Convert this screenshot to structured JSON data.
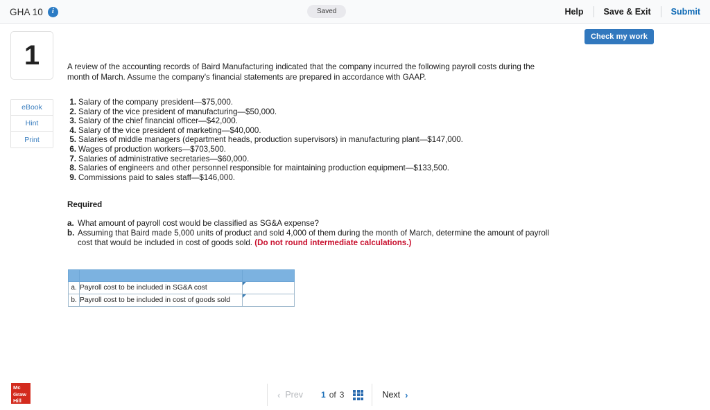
{
  "header": {
    "assignment_title": "GHA 10",
    "info_icon": "info-icon",
    "saved_label": "Saved",
    "help_label": "Help",
    "save_exit_label": "Save & Exit",
    "submit_label": "Submit"
  },
  "toolbar": {
    "check_my_work_label": "Check my work"
  },
  "left_rail": {
    "question_number": "1",
    "tools": [
      {
        "label": "eBook",
        "name": "ebook-button"
      },
      {
        "label": "Hint",
        "name": "hint-button"
      },
      {
        "label": "Print",
        "name": "print-button"
      }
    ]
  },
  "question": {
    "intro": "A review of the accounting records of Baird Manufacturing indicated that the company incurred the following payroll costs during the month of March. Assume the company's financial statements are prepared in accordance with GAAP.",
    "items": [
      {
        "num": "1.",
        "text": "Salary of the company president—$75,000."
      },
      {
        "num": "2.",
        "text": "Salary of the vice president of manufacturing—$50,000."
      },
      {
        "num": "3.",
        "text": "Salary of the chief financial officer—$42,000."
      },
      {
        "num": "4.",
        "text": "Salary of the vice president of marketing—$40,000."
      },
      {
        "num": "5.",
        "text": "Salaries of middle managers (department heads, production supervisors) in manufacturing plant—$147,000."
      },
      {
        "num": "6.",
        "text": "Wages of production workers—$703,500."
      },
      {
        "num": "7.",
        "text": "Salaries of administrative secretaries—$60,000."
      },
      {
        "num": "8.",
        "text": "Salaries of engineers and other personnel responsible for maintaining production equipment—$133,500."
      },
      {
        "num": "9.",
        "text": "Commissions paid to sales staff—$146,000."
      }
    ],
    "required_heading": "Required",
    "requirements": [
      {
        "letter": "a.",
        "text": "What amount of payroll cost would be classified as SG&A expense?",
        "emphasis": ""
      },
      {
        "letter": "b.",
        "text": "Assuming that Baird made 5,000 units of product and sold 4,000 of them during the month of March, determine the amount of payroll cost that would be included in cost of goods sold. ",
        "emphasis": "(Do not round intermediate calculations.)"
      }
    ]
  },
  "answer_table": {
    "header_cells": [
      "",
      "",
      ""
    ],
    "rows": [
      {
        "letter": "a.",
        "label": "Payroll cost to be included in SG&A cost",
        "value": ""
      },
      {
        "letter": "b.",
        "label": "Payroll cost to be included in cost of goods sold",
        "value": ""
      }
    ]
  },
  "footer": {
    "logo_line1": "Mc",
    "logo_line2": "Graw",
    "logo_line3": "Hill",
    "prev_label": "Prev",
    "next_label": "Next",
    "current_page": "1",
    "of_label": "of",
    "total_pages": "3",
    "grid_icon": "grid-icon"
  },
  "colors": {
    "accent_blue": "#3178be",
    "link_blue": "#0d69b5",
    "table_header_blue": "#7cb2e0",
    "input_border_blue": "#3e7fb5",
    "red_emphasis": "#c8102e",
    "logo_red": "#d32b1e"
  }
}
